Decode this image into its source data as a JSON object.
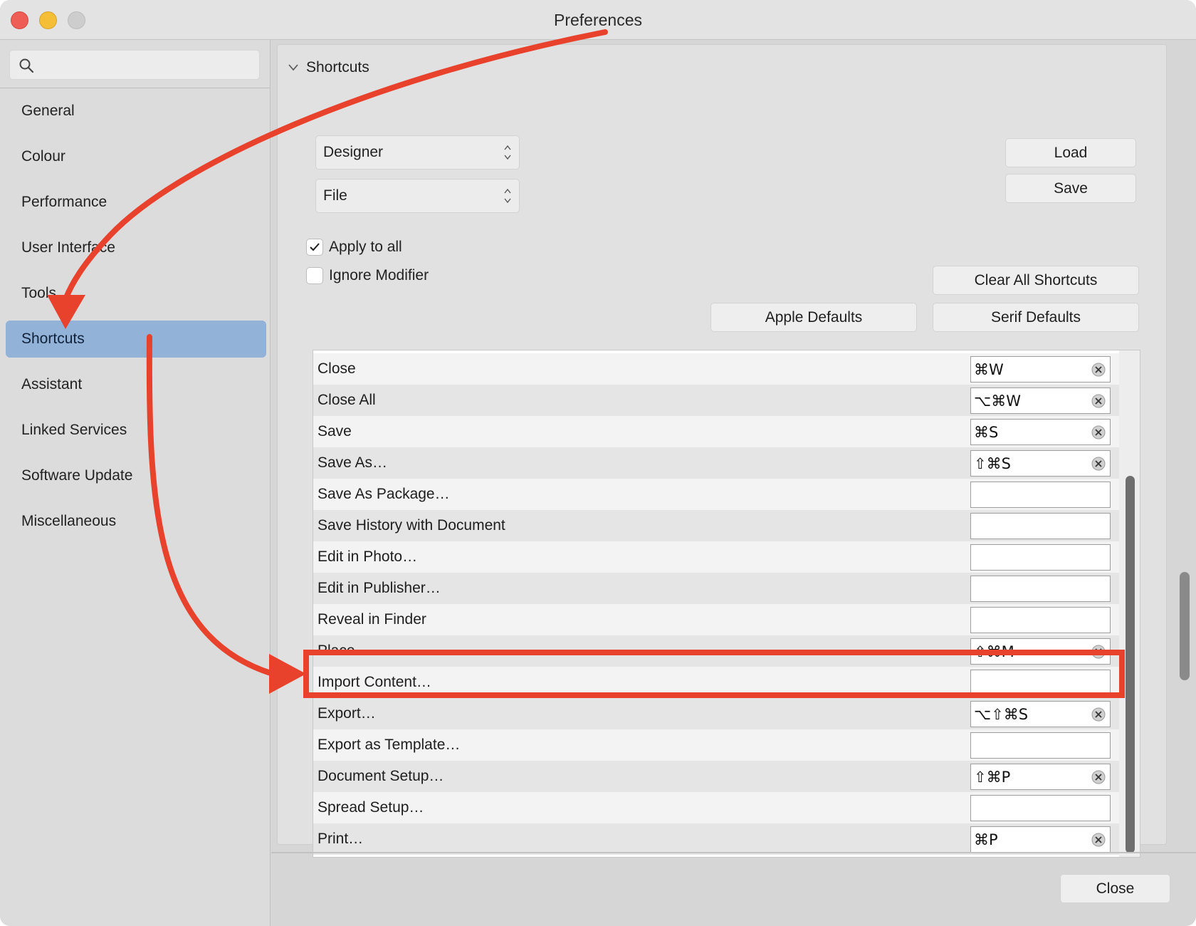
{
  "window": {
    "title": "Preferences"
  },
  "sidebar": {
    "search": {
      "value": "",
      "placeholder": ""
    },
    "items": [
      {
        "label": "General"
      },
      {
        "label": "Colour"
      },
      {
        "label": "Performance"
      },
      {
        "label": "User Interface"
      },
      {
        "label": "Tools"
      },
      {
        "label": "Shortcuts",
        "selected": true
      },
      {
        "label": "Assistant"
      },
      {
        "label": "Linked Services"
      },
      {
        "label": "Software Update"
      },
      {
        "label": "Miscellaneous"
      }
    ]
  },
  "shortcuts": {
    "section_title": "Shortcuts",
    "app_popup": "Designer",
    "category_popup": "File",
    "load_label": "Load",
    "save_label": "Save",
    "apply_to_all": {
      "label": "Apply to all",
      "checked": true
    },
    "ignore_modifier": {
      "label": "Ignore Modifier",
      "checked": false
    },
    "clear_all_label": "Clear All Shortcuts",
    "apple_defaults_label": "Apple Defaults",
    "serif_defaults_label": "Serif Defaults",
    "rows": [
      {
        "label": "Close",
        "key": "⌘W"
      },
      {
        "label": "Close All",
        "key": "⌥⌘W"
      },
      {
        "label": "Save",
        "key": "⌘S"
      },
      {
        "label": "Save As…",
        "key": "⇧⌘S"
      },
      {
        "label": "Save As Package…",
        "key": ""
      },
      {
        "label": "Save History with Document",
        "key": ""
      },
      {
        "label": "Edit in Photo…",
        "key": ""
      },
      {
        "label": "Edit in Publisher…",
        "key": ""
      },
      {
        "label": "Reveal in Finder",
        "key": ""
      },
      {
        "label": "Place…",
        "key": "⇧⌘M"
      },
      {
        "label": "Import Content…",
        "key": ""
      },
      {
        "label": "Export…",
        "key": "⌥⇧⌘S",
        "highlighted": true
      },
      {
        "label": "Export as Template…",
        "key": ""
      },
      {
        "label": "Document Setup…",
        "key": "⇧⌘P"
      },
      {
        "label": "Spread Setup…",
        "key": ""
      },
      {
        "label": "Print…",
        "key": "⌘P"
      }
    ]
  },
  "footer": {
    "close_label": "Close"
  },
  "annotation": {
    "color": "#e8412c"
  }
}
